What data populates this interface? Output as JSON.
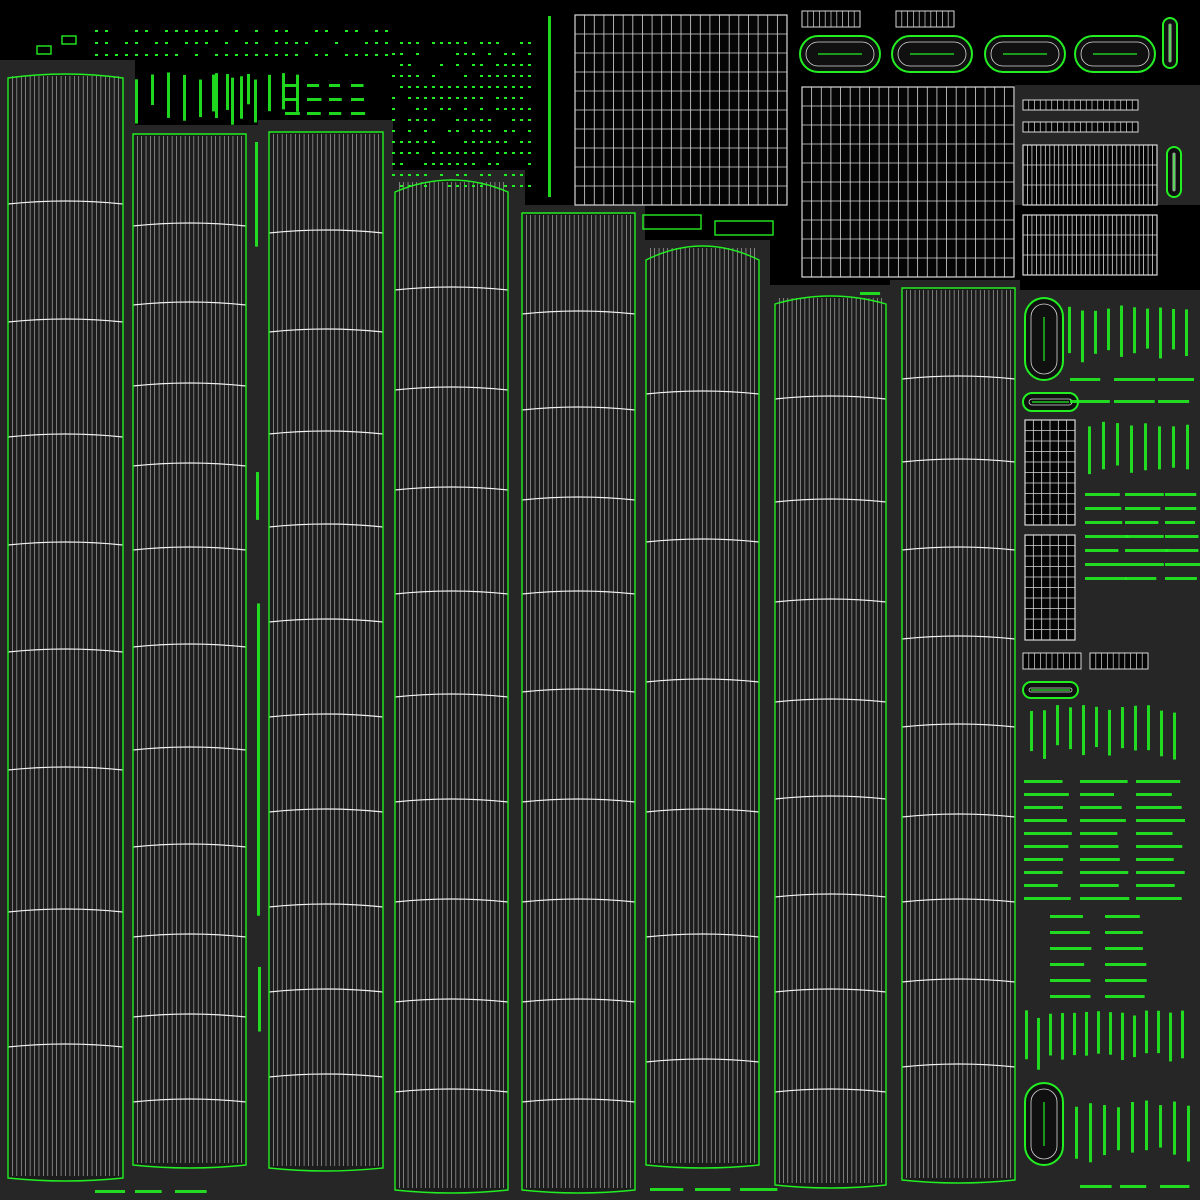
{
  "colors": {
    "background": "#000000",
    "shell_fill": "#262626",
    "shell_fill_dark": "#1c1c1c",
    "wire": "#d8d8d8",
    "seam": "#22ee22"
  },
  "uv_layout": {
    "tall_strips": 8,
    "wire_grids": 3,
    "capsule_islands": 6,
    "rib_islands": 2
  }
}
